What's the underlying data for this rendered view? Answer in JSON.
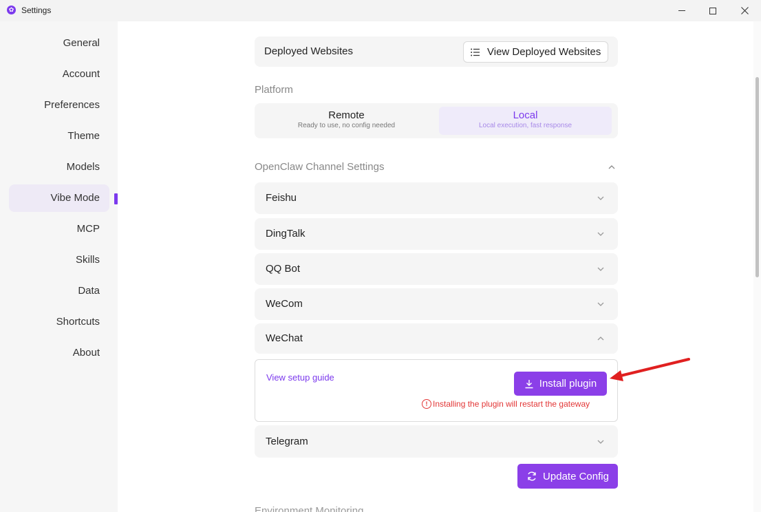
{
  "window": {
    "title": "Settings",
    "app_icon": "app-logo-icon"
  },
  "sidebar": {
    "items": [
      {
        "label": "General"
      },
      {
        "label": "Account"
      },
      {
        "label": "Preferences"
      },
      {
        "label": "Theme"
      },
      {
        "label": "Models"
      },
      {
        "label": "Vibe Mode",
        "active": true
      },
      {
        "label": "MCP"
      },
      {
        "label": "Skills"
      },
      {
        "label": "Data"
      },
      {
        "label": "Shortcuts"
      },
      {
        "label": "About"
      }
    ]
  },
  "main": {
    "deployed": {
      "label": "Deployed Websites",
      "button_label": "View Deployed Websites",
      "button_icon": "list-icon"
    },
    "platform": {
      "section_label": "Platform",
      "options": [
        {
          "title": "Remote",
          "subtitle": "Ready to use, no config needed",
          "selected": false
        },
        {
          "title": "Local",
          "subtitle": "Local execution, fast response",
          "selected": true
        }
      ]
    },
    "channels": {
      "section_label": "OpenClaw Channel Settings",
      "items": [
        {
          "name": "Feishu",
          "expanded": false
        },
        {
          "name": "DingTalk",
          "expanded": false
        },
        {
          "name": "QQ Bot",
          "expanded": false
        },
        {
          "name": "WeCom",
          "expanded": false
        },
        {
          "name": "WeChat",
          "expanded": true
        },
        {
          "name": "Telegram",
          "expanded": false
        }
      ],
      "wechat_panel": {
        "guide_link": "View setup guide",
        "install_button": "Install plugin",
        "warning": "Installing the plugin will restart the gateway"
      },
      "update_button": "Update Config"
    },
    "environment_section_label": "Environment Monitoring"
  },
  "colors": {
    "accent": "#8b3fe8",
    "warning": "#e23636",
    "annotation_arrow": "#e02020"
  }
}
